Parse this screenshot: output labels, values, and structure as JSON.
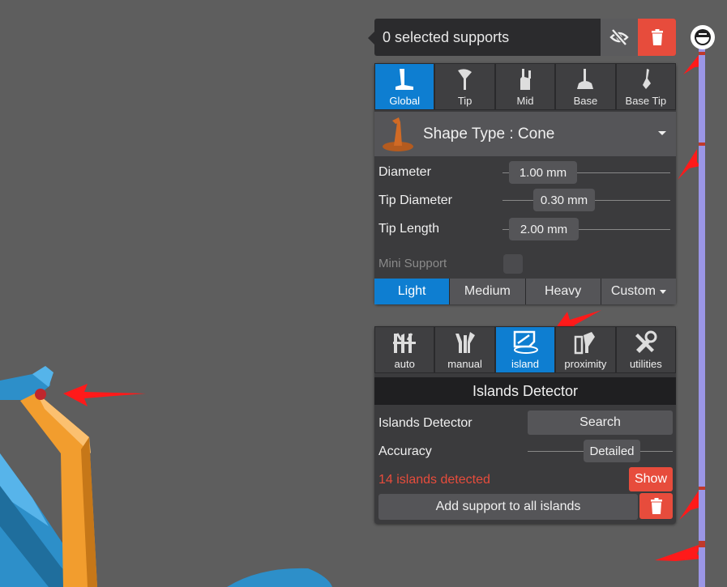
{
  "selection": {
    "text": "0 selected supports"
  },
  "support_tabs": [
    {
      "label": "Global",
      "icon": "global-support-icon",
      "active": true
    },
    {
      "label": "Tip",
      "icon": "tip-support-icon",
      "active": false
    },
    {
      "label": "Mid",
      "icon": "mid-support-icon",
      "active": false
    },
    {
      "label": "Base",
      "icon": "base-support-icon",
      "active": false
    },
    {
      "label": "Base Tip",
      "icon": "base-tip-support-icon",
      "active": false
    }
  ],
  "shape_type": {
    "label": "Shape Type : Cone"
  },
  "params": {
    "diameter": {
      "label": "Diameter",
      "value": "1.00 mm"
    },
    "tip_diameter": {
      "label": "Tip Diameter",
      "value": "0.30 mm"
    },
    "tip_length": {
      "label": "Tip Length",
      "value": "2.00 mm"
    }
  },
  "mini_support": {
    "label": "Mini Support"
  },
  "density": {
    "light": "Light",
    "medium": "Medium",
    "heavy": "Heavy",
    "custom": "Custom",
    "selected": "Light"
  },
  "tool_tabs": [
    {
      "label": "auto",
      "icon": "auto-icon",
      "active": false
    },
    {
      "label": "manual",
      "icon": "manual-icon",
      "active": false
    },
    {
      "label": "island",
      "icon": "island-icon",
      "active": true
    },
    {
      "label": "proximity",
      "icon": "proximity-icon",
      "active": false
    },
    {
      "label": "utilities",
      "icon": "utilities-icon",
      "active": false
    }
  ],
  "islands": {
    "header": "Islands Detector",
    "detector_label": "Islands Detector",
    "search_label": "Search",
    "accuracy_label": "Accuracy",
    "accuracy_value": "Detailed",
    "detected_text": "14 islands detected",
    "show_label": "Show",
    "add_all_label": "Add support to all islands"
  },
  "colors": {
    "accent": "#0e7ed1",
    "danger": "#e74c3c",
    "panel": "#3b3b3d",
    "model_blue": "#2d8fc9",
    "model_orange": "#f29d2e"
  }
}
